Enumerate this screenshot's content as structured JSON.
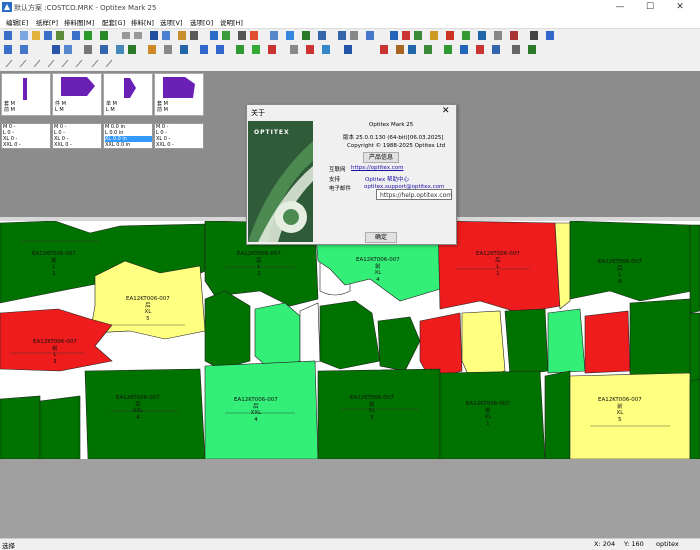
{
  "window": {
    "title": "默认方案 :COSTCO.MRK - Optitex Mark 25",
    "minimize": "—",
    "maximize": "☐",
    "close": "✕"
  },
  "menu": [
    "编辑[E]",
    "纸样[P]",
    "排料图[M]",
    "配套[G]",
    "排料[N]",
    "选项[V]",
    "选项[O]",
    "说明[H]"
  ],
  "pieces": [
    {
      "label1": "套 M",
      "label2": "前 M",
      "num": "1",
      "color": "#6a1fb5"
    },
    {
      "label1": "件 M",
      "label2": "L M",
      "num": "1",
      "color": "#6a1fb5"
    },
    {
      "label1": "单 M",
      "label2": "L M",
      "num": "1",
      "color": "#6a1fb5"
    },
    {
      "label1": "套 M",
      "label2": "前 M",
      "num": "1",
      "color": "#6a1fb5"
    }
  ],
  "size_tables": [
    {
      "rows": [
        "M  0 -",
        "L  0 -",
        "XL  0 -",
        "XXL  0 -"
      ],
      "selected": -1
    },
    {
      "rows": [
        "M  0 -",
        "L  0 -",
        "XL  0 -",
        "XXL  0 -"
      ],
      "selected": -1
    },
    {
      "rows": [
        "M  0.0 in",
        "L  0.0 in",
        "XL  0.0 in",
        "XXL  0.0 in"
      ],
      "selected": 2
    },
    {
      "rows": [
        "M  0 -",
        "L  0 -",
        "XL  0 -",
        "XXL  0 -"
      ],
      "selected": -1
    }
  ],
  "marker_colors": {
    "dark_green": "#007200",
    "light_green": "#33ee77",
    "red": "#ee1c1c",
    "yellow": "#ffff80",
    "violet": "#7a1fd0"
  },
  "marker_labels": [
    {
      "code": "EA12KT006-007",
      "part": "前",
      "size": "L",
      "qty": "1"
    },
    {
      "code": "EA12KT006-007",
      "part": "后",
      "size": "L",
      "qty": "2"
    },
    {
      "code": "EA12KT006-007",
      "part": "前",
      "size": "XL",
      "qty": "4"
    },
    {
      "code": "EA12KT006-007",
      "part": "后",
      "size": "L",
      "qty": "1"
    },
    {
      "code": "EA12KT006-007",
      "part": "后",
      "size": "L",
      "qty": "6"
    },
    {
      "code": "EA12KT006-007",
      "part": "后",
      "size": "XL",
      "qty": "5"
    },
    {
      "code": "EA12KT006-007",
      "part": "前",
      "size": "L",
      "qty": "3"
    },
    {
      "code": "EA12KT006-007",
      "part": "后",
      "size": "XXL",
      "qty": "4"
    },
    {
      "code": "EA12KT006-007",
      "part": "后",
      "size": "XXL",
      "qty": "4"
    },
    {
      "code": "EA12KT006-007",
      "part": "前",
      "size": "XL",
      "qty": "3"
    },
    {
      "code": "EA12KT006-007",
      "part": "前",
      "size": "XL",
      "qty": "1"
    },
    {
      "code": "EA12KT006-007",
      "part": "前",
      "size": "XL",
      "qty": "5"
    }
  ],
  "dialog": {
    "title": "关于",
    "close": "✕",
    "brand": "OPTITEX",
    "product": "Optitex Mark 25",
    "version": "版本 25.0.0.130  (64-bit)[06.03.2025]",
    "copyright": "Copyright © 1988-2025 Optitex Ltd",
    "product_info_button": "产品信息",
    "internet_label": "互联网",
    "internet_value": "https://optitex.com",
    "support_label": "支持",
    "support_value": "Optitex 帮助中心",
    "email_label": "电子邮件",
    "email_value": "optitex.support@optitex.com",
    "ok_button": "确定"
  },
  "tooltip": "https://help.optitex.com",
  "status": {
    "left": "选择",
    "x": "X: 204",
    "y": "Y: 160",
    "user": "optitex"
  }
}
